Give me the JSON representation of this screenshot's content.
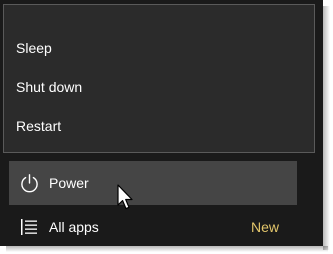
{
  "power_menu": {
    "items": [
      {
        "label": "Sleep"
      },
      {
        "label": "Shut down"
      },
      {
        "label": "Restart"
      }
    ]
  },
  "start": {
    "power_label": "Power",
    "power_icon": "power-icon",
    "all_apps_label": "All apps",
    "all_apps_icon": "list-icon",
    "new_badge": "New"
  },
  "colors": {
    "panel_background": "#1a1a1a",
    "menu_background": "#2b2b2b",
    "menu_border": "#5a5a5a",
    "power_hover": "#454545",
    "text": "#ffffff",
    "new_badge": "#e3c66b"
  }
}
